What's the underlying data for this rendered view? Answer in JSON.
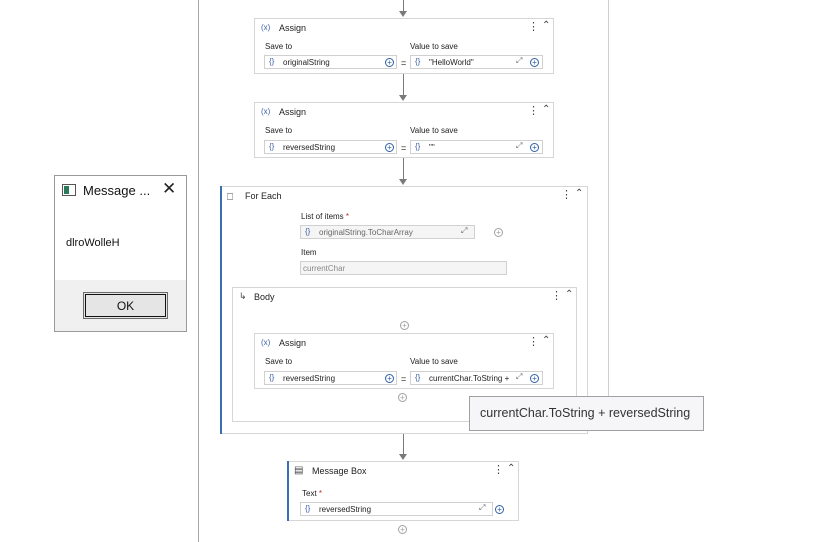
{
  "dialog": {
    "title": "Message ...",
    "message": "dlroWolleH",
    "ok_label": "OK"
  },
  "assign1": {
    "title": "Assign",
    "save_to_label": "Save to",
    "value_label": "Value to save",
    "save_to": "originalString",
    "value": "\"HelloWorld\""
  },
  "assign2": {
    "title": "Assign",
    "save_to_label": "Save to",
    "value_label": "Value to save",
    "save_to": "reversedString",
    "value": "\"\""
  },
  "foreach": {
    "title": "For Each",
    "list_label": "List of items",
    "list_value": "originalString.ToCharArray",
    "item_label": "Item",
    "item_value": "currentChar",
    "body_title": "Body"
  },
  "assign3": {
    "title": "Assign",
    "save_to_label": "Save to",
    "value_label": "Value to save",
    "save_to": "reversedString",
    "value": "currentChar.ToString +"
  },
  "tooltip": {
    "text": "currentChar.ToString + reversedString"
  },
  "msgbox": {
    "title": "Message Box",
    "text_label": "Text",
    "text_value": "reversedString"
  },
  "common": {
    "required_mark": "*",
    "equals": "=",
    "brace": "{}",
    "var_icon": "(x)"
  },
  "colors": {
    "accent": "#3b6fb3",
    "border": "#d6d6d6",
    "connector": "#7a7a7a"
  }
}
